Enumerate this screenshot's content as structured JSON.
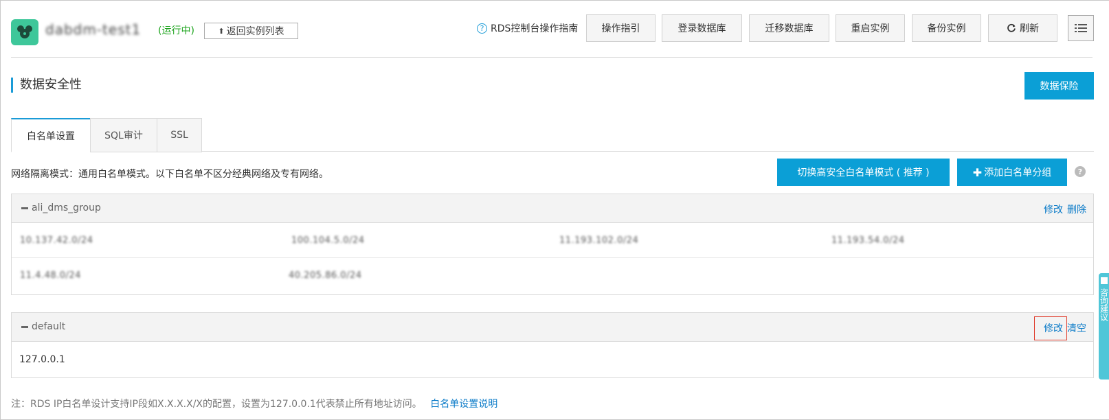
{
  "header": {
    "instance_name": "dabdm-test1",
    "status": "(运行中)",
    "back_label": "返回实例列表",
    "guide_label": "RDS控制台操作指南",
    "buttons": [
      "操作指引",
      "登录数据库",
      "迁移数据库",
      "重启实例",
      "备份实例",
      "刷新"
    ]
  },
  "section": {
    "title": "数据安全性",
    "protect_button": "数据保险"
  },
  "tabs": [
    "白名单设置",
    "SQL审计",
    "SSL"
  ],
  "whitelist": {
    "mode_text": "网络隔离模式：通用白名单模式。以下白名单不区分经典网络及专有网络。",
    "switch_button": "切换高安全白名单模式 ( 推荐 )",
    "add_button": "添加白名单分组",
    "groups": [
      {
        "name": "ali_dms_group",
        "actions": [
          "修改",
          "删除"
        ],
        "rows": [
          [
            "10.137.42.0/24",
            "100.104.5.0/24",
            "11.193.102.0/24",
            "11.193.54.0/24"
          ],
          [
            "11.4.48.0/24",
            "40.205.86.0/24"
          ]
        ]
      },
      {
        "name": "default",
        "actions": [
          "修改",
          "清空"
        ],
        "rows": [
          [
            "127.0.0.1"
          ]
        ]
      }
    ]
  },
  "note": {
    "text": "注：RDS IP白名单设计支持IP段如X.X.X.X/X的配置，设置为127.0.0.1代表禁止所有地址访问。",
    "link": "白名单设置说明"
  },
  "float_tab": {
    "label": "咨询建议"
  },
  "colors": {
    "primary": "#0b9fd6",
    "link": "#0b7bc8",
    "status_green": "#1aa31a",
    "highlight_red": "#e03c2c"
  }
}
